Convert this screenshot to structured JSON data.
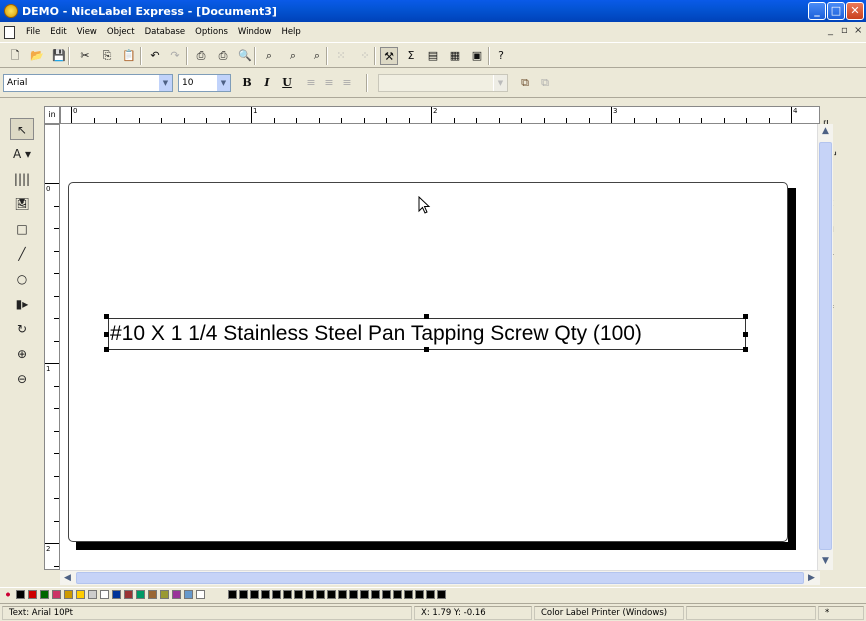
{
  "window": {
    "title": "DEMO - NiceLabel Express - [Document3]",
    "controls": {
      "minimize": "_",
      "maximize": "□",
      "close": "✕"
    }
  },
  "menubar": {
    "items": [
      "File",
      "Edit",
      "View",
      "Object",
      "Database",
      "Options",
      "Window",
      "Help"
    ],
    "mdi_controls": [
      "_",
      "▫",
      "×"
    ]
  },
  "toolbar": {
    "buttons": [
      {
        "name": "new-icon",
        "glyph": "🗋"
      },
      {
        "name": "open-icon",
        "glyph": "📂"
      },
      {
        "name": "save-icon",
        "glyph": "💾"
      },
      {
        "name": "cut-icon",
        "glyph": "✂"
      },
      {
        "name": "copy-icon",
        "glyph": "⎘"
      },
      {
        "name": "paste-icon",
        "glyph": "📋"
      },
      {
        "name": "undo-icon",
        "glyph": "↶"
      },
      {
        "name": "redo-icon",
        "glyph": "↷"
      },
      {
        "name": "print-icon",
        "glyph": "⎙"
      },
      {
        "name": "print-direct-icon",
        "glyph": "⎙"
      },
      {
        "name": "print-preview-icon",
        "glyph": "🔍"
      },
      {
        "name": "zoom-page-icon",
        "glyph": "⌕"
      },
      {
        "name": "zoom-in-icon",
        "glyph": "⌕"
      },
      {
        "name": "zoom-out-icon",
        "glyph": "⌕"
      },
      {
        "name": "grid-icon",
        "glyph": "⁙"
      },
      {
        "name": "snap-icon",
        "glyph": "⁘"
      },
      {
        "name": "properties-icon",
        "glyph": "⚒"
      },
      {
        "name": "variables-icon",
        "glyph": "Σ"
      },
      {
        "name": "database-icon",
        "glyph": "▤"
      },
      {
        "name": "functions-icon",
        "glyph": "▦"
      },
      {
        "name": "label-setup-icon",
        "glyph": "▣"
      },
      {
        "name": "help-icon",
        "glyph": "?"
      }
    ]
  },
  "format": {
    "font": "Arial",
    "size": "10",
    "bold": "B",
    "italic": "I",
    "underline": "U",
    "align_left": "≡",
    "align_center": "≡",
    "align_right": "≡",
    "style_combo": "",
    "bring_front": "⧉",
    "send_back": "⧉"
  },
  "left_tools": [
    {
      "name": "select-tool-icon",
      "glyph": "↖"
    },
    {
      "name": "text-tool-icon",
      "glyph": "A ▾"
    },
    {
      "name": "barcode-tool-icon",
      "glyph": "|||| ▾"
    },
    {
      "name": "picture-tool-icon",
      "glyph": "🖼"
    },
    {
      "name": "rectangle-tool-icon",
      "glyph": "□"
    },
    {
      "name": "line-tool-icon",
      "glyph": "╱"
    },
    {
      "name": "ellipse-tool-icon",
      "glyph": "○"
    },
    {
      "name": "inverse-tool-icon",
      "glyph": "▮▸"
    },
    {
      "name": "rotate-tool-icon",
      "glyph": "↻"
    },
    {
      "name": "zoom-in-tool-icon",
      "glyph": "⊕"
    },
    {
      "name": "zoom-out-tool-icon",
      "glyph": "⊖"
    }
  ],
  "right_tools": [
    {
      "name": "align-top-icon",
      "glyph": "⸢⎸"
    },
    {
      "name": "align-bottom-icon",
      "glyph": "⎸⸥"
    },
    {
      "name": "align-vcenter-icon",
      "glyph": "⸥⸢"
    },
    {
      "name": "align-left-icon",
      "glyph": "⊏"
    },
    {
      "name": "align-right-icon",
      "glyph": "⊐"
    },
    {
      "name": "align-hcenter-icon",
      "glyph": "⊢"
    },
    {
      "name": "space-horizontal-icon",
      "glyph": "⫿⫿"
    },
    {
      "name": "space-vertical-icon",
      "glyph": "⊨"
    }
  ],
  "rulers": {
    "unit": "in",
    "h_labels": [
      "0",
      "1",
      "2",
      "3",
      "4"
    ],
    "v_labels": [
      "0",
      "1",
      "2"
    ]
  },
  "label": {
    "text_object": "#10 X 1 1/4 Stainless Steel Pan Tapping Screw Qty (100)"
  },
  "palette": {
    "colors": [
      "#000000",
      "#cc0000",
      "#006600",
      "#cc3366",
      "#cc9900",
      "#ffcc00",
      "#cccccc",
      "#ffffff",
      "#003399",
      "#993333",
      "#009966",
      "#996633",
      "#999933",
      "#993399",
      "#6699cc",
      "#ffffff"
    ],
    "black_swatches": 20
  },
  "status": {
    "object": "Text: Arial 10Pt",
    "coords": "X: 1.79 Y: -0.16",
    "printer": "Color Label Printer (Windows)",
    "extra": "*"
  }
}
